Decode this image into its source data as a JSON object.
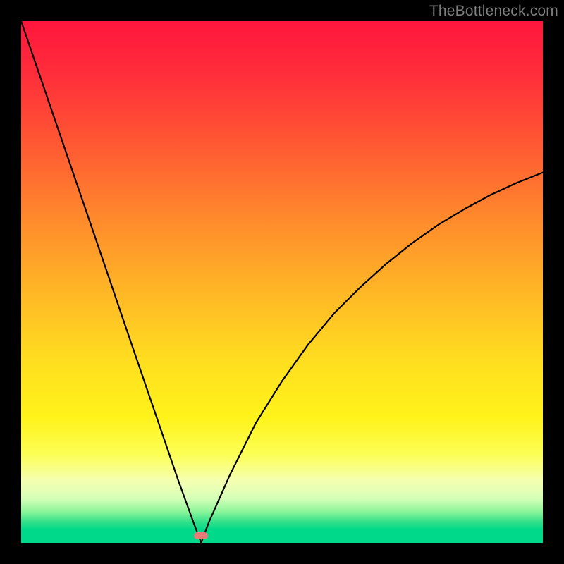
{
  "watermark": {
    "text": "TheBottleneck.com"
  },
  "colors": {
    "frame": "#000000",
    "curve": "#000000",
    "marker": "#e77c79",
    "gradient_stops": [
      "#ff163d",
      "#ff2d3a",
      "#ff5a33",
      "#ff8a2c",
      "#ffb726",
      "#ffe01f",
      "#fff31a",
      "#fcff55",
      "#f5ffb0",
      "#d6ffb8",
      "#8cf59a",
      "#33e08a",
      "#00d98a"
    ]
  },
  "marker": {
    "x_frac": 0.345,
    "y_frac": 0.986
  },
  "chart_data": {
    "type": "line",
    "title": "",
    "xlabel": "",
    "ylabel": "",
    "xlim": [
      0,
      1
    ],
    "ylim": [
      0,
      1
    ],
    "series": [
      {
        "name": "bottleneck-curve",
        "x": [
          0.0,
          0.05,
          0.1,
          0.15,
          0.2,
          0.25,
          0.3,
          0.33,
          0.345,
          0.36,
          0.4,
          0.45,
          0.5,
          0.55,
          0.6,
          0.65,
          0.7,
          0.75,
          0.8,
          0.85,
          0.9,
          0.95,
          1.0
        ],
        "y": [
          0.0,
          0.146,
          0.292,
          0.438,
          0.585,
          0.731,
          0.877,
          0.96,
          1.0,
          0.96,
          0.87,
          0.77,
          0.69,
          0.62,
          0.56,
          0.51,
          0.465,
          0.425,
          0.39,
          0.36,
          0.333,
          0.31,
          0.29
        ]
      }
    ],
    "minimum_marker": {
      "x": 0.345,
      "y": 1.0
    },
    "notes": "y=0 at top of plot, y=1 at bottom (optimal). Curve descends linearly from top-left to a sharp minimum near x≈0.345, then rises with decreasing slope toward the right edge."
  }
}
